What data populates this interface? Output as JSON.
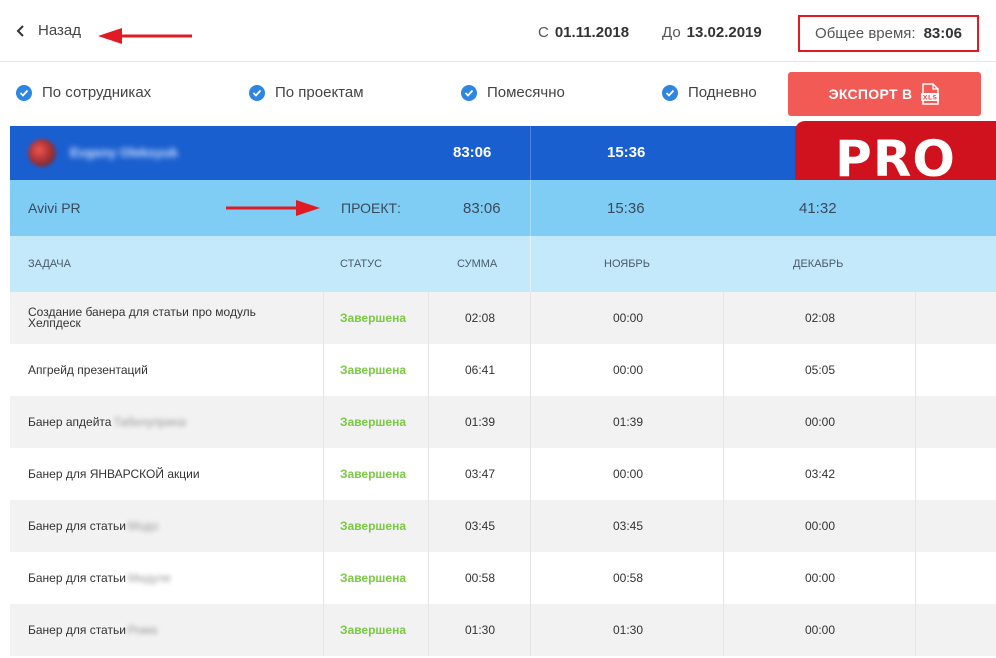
{
  "header": {
    "back_label": "Назад",
    "date_from_label": "С",
    "date_from": "01.11.2018",
    "date_to_label": "До",
    "date_to": "13.02.2019",
    "total_label": "Общее время:",
    "total_value": "83:06"
  },
  "filters": {
    "by_employees": "По сотрудниках",
    "by_projects": "По проектам",
    "monthly": "Помесячно",
    "daily": "Подневно",
    "export_label": "ЭКСПОРТ В"
  },
  "badge": "PRO",
  "employee": {
    "name": "Evgeny Oleksyuk",
    "sum": "83:06",
    "november": "15:36"
  },
  "project": {
    "name": "Avivi PR",
    "label": "ПРОЕКТ:",
    "sum": "83:06",
    "november": "15:36",
    "december": "41:32"
  },
  "columns": {
    "task": "ЗАДАЧА",
    "status": "СТАТУС",
    "sum": "СУММА",
    "november": "НОЯБРЬ",
    "december": "ДЕКАБРЬ"
  },
  "rows": [
    {
      "task": "Создание банера для статьи про модуль Хелпдеск",
      "blur": "",
      "status": "Завершена",
      "sum": "02:08",
      "november": "00:00",
      "december": "02:08"
    },
    {
      "task": "Апгрейд презентаций",
      "blur": "",
      "status": "Завершена",
      "sum": "06:41",
      "november": "00:00",
      "december": "05:05"
    },
    {
      "task": "Банер апдейта",
      "blur": "Табелуприна",
      "status": "Завершена",
      "sum": "01:39",
      "november": "01:39",
      "december": "00:00"
    },
    {
      "task": "Банер для ЯНВАРСКОЙ акции",
      "blur": "",
      "status": "Завершена",
      "sum": "03:47",
      "november": "00:00",
      "december": "03:42"
    },
    {
      "task": "Банер для статьи",
      "blur": "Модо",
      "status": "Завершена",
      "sum": "03:45",
      "november": "03:45",
      "december": "00:00"
    },
    {
      "task": "Банер для статьи",
      "blur": "Мидуле",
      "status": "Завершена",
      "sum": "00:58",
      "november": "00:58",
      "december": "00:00"
    },
    {
      "task": "Банер для статьи",
      "blur": "Рома",
      "status": "Завершена",
      "sum": "01:30",
      "november": "01:30",
      "december": "00:00"
    }
  ]
}
